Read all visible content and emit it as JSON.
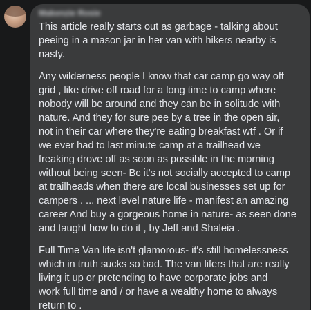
{
  "comment": {
    "author": "Makenzie Rosie",
    "paragraphs": [
      [
        "This article really starts out as garbage - talking about",
        "peeing in a mason jar in her van with hikers nearby is",
        "nasty."
      ],
      [
        "Any wilderness people I know that car camp go way off",
        "grid , like drive off road for a long time to camp where",
        "nobody will be around and they can be in solitude with",
        "nature. And they for sure pee by a tree in the open air,",
        "not in their car where they're eating breakfast wtf . Or if",
        "we ever had to last minute camp at a trailhead we",
        "freaking drove off as soon as possible in the morning",
        "without being seen- Bc it's not socially accepted to camp",
        "at trailheads when there are local businesses set up for",
        "campers . ... next level nature life - manifest an amazing",
        "career And buy a gorgeous home in nature- as seen done",
        "and taught how to do it , by Jeff and Shaleia ."
      ],
      [
        "Full Time Van life isn't glamorous- it's still homelessness",
        "which in truth sucks so bad. The van lifers that are really",
        "living it up or pretending to have corporate jobs and",
        "work full time and / or have a wealthy home to always",
        "return to ."
      ]
    ]
  }
}
